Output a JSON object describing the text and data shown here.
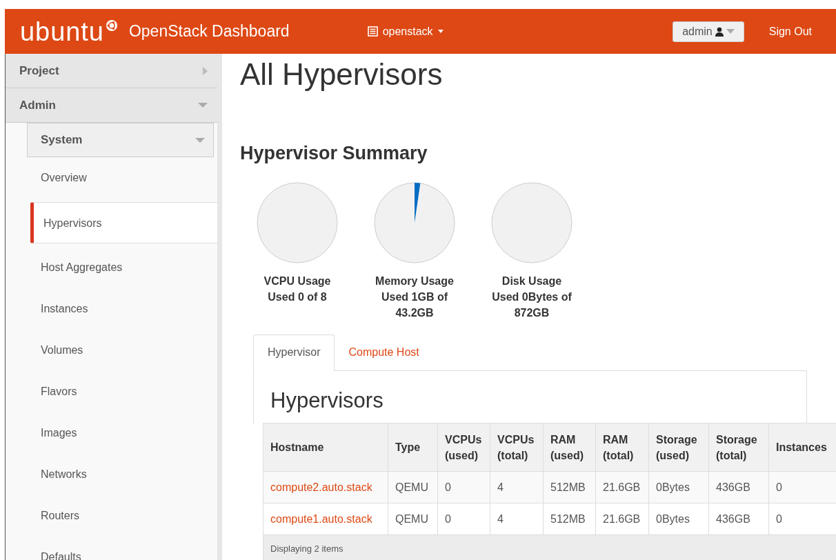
{
  "header": {
    "logo": "ubuntu",
    "title": "OpenStack Dashboard",
    "project_menu": "openstack",
    "user_menu": "admin",
    "sign_out": "Sign Out"
  },
  "sidebar": {
    "items": [
      {
        "label": "Project",
        "expanded": false
      },
      {
        "label": "Admin",
        "expanded": true,
        "children": [
          {
            "label": "System",
            "expanded": true,
            "children": [
              {
                "label": "Overview",
                "selected": false
              },
              {
                "label": "Hypervisors",
                "selected": true
              },
              {
                "label": "Host Aggregates",
                "selected": false
              },
              {
                "label": "Instances",
                "selected": false
              },
              {
                "label": "Volumes",
                "selected": false
              },
              {
                "label": "Flavors",
                "selected": false
              },
              {
                "label": "Images",
                "selected": false
              },
              {
                "label": "Networks",
                "selected": false
              },
              {
                "label": "Routers",
                "selected": false
              },
              {
                "label": "Defaults",
                "selected": false
              }
            ]
          }
        ]
      }
    ]
  },
  "page_title": "All Hypervisors",
  "summary": {
    "title": "Hypervisor Summary",
    "charts": [
      {
        "label": "VCPU Usage",
        "detail": "Used 0 of 8"
      },
      {
        "label": "Memory Usage",
        "detail": "Used 1GB of 43.2GB"
      },
      {
        "label": "Disk Usage",
        "detail": "Used 0Bytes of 872GB"
      }
    ]
  },
  "tabs": [
    {
      "label": "Hypervisor",
      "selected": true
    },
    {
      "label": "Compute Host",
      "selected": false
    }
  ],
  "table": {
    "title": "Hypervisors",
    "columns": [
      "Hostname",
      "Type",
      "VCPUs (used)",
      "VCPUs (total)",
      "RAM (used)",
      "RAM (total)",
      "Storage (used)",
      "Storage (total)",
      "Instances"
    ],
    "rows": [
      [
        "compute2.auto.stack",
        "QEMU",
        "0",
        "4",
        "512MB",
        "21.6GB",
        "0Bytes",
        "436GB",
        "0"
      ],
      [
        "compute1.auto.stack",
        "QEMU",
        "0",
        "4",
        "512MB",
        "21.6GB",
        "0Bytes",
        "436GB",
        "0"
      ]
    ],
    "footer": "Displaying 2 items"
  }
}
